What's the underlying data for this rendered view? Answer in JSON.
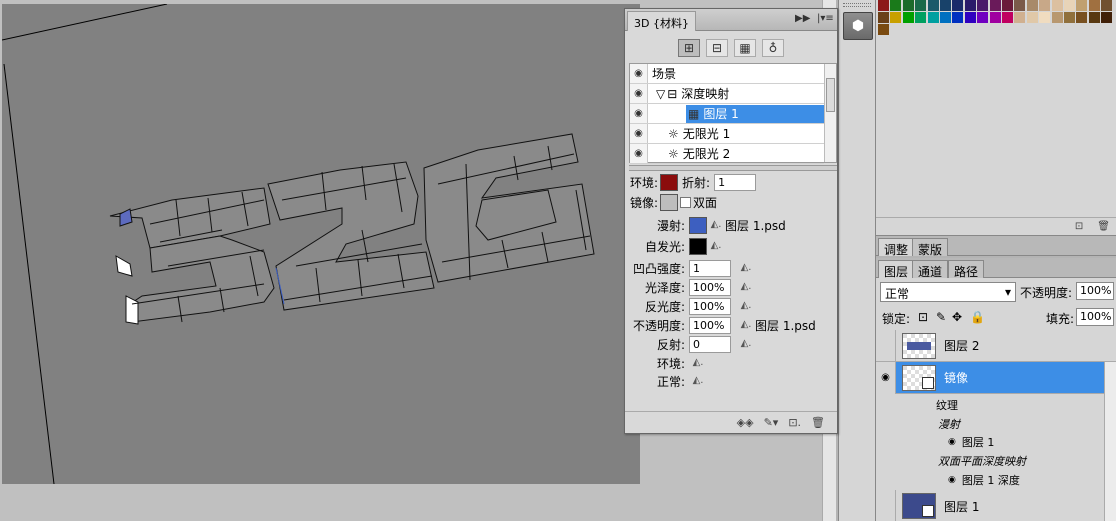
{
  "panel3d": {
    "tab_label": "3D {材料}",
    "menu_glyph": "▸▸ | ▾≡",
    "filter_icons": [
      "scene-filter-icon",
      "mesh-filter-icon",
      "material-filter-icon",
      "light-filter-icon"
    ],
    "scene_rows": [
      {
        "label": "场景",
        "indent": 0,
        "icon": ""
      },
      {
        "label": "深度映射",
        "indent": 1,
        "icon": "▽ ⊟"
      },
      {
        "label": "图层 1",
        "indent": 3,
        "icon": "▦",
        "selected": true
      },
      {
        "label": "无限光 1",
        "indent": 2,
        "icon": "☼"
      },
      {
        "label": "无限光 2",
        "indent": 2,
        "icon": "☼"
      }
    ],
    "props": {
      "ambient_label": "环境:",
      "refraction_label": "折射:",
      "refraction_value": "1",
      "specular_label": "镜像:",
      "double_sided_label": "双面",
      "diffuse_label": "漫射:",
      "diffuse_texture": "图层 1.psd",
      "self_illum_label": "自发光:",
      "bump_label": "凹凸强度:",
      "bump_value": "1",
      "gloss_label": "光泽度:",
      "gloss_value": "100%",
      "shine_label": "反光度:",
      "shine_value": "100%",
      "opacity_label": "不透明度:",
      "opacity_value": "100%",
      "opacity_texture": "图层 1.psd",
      "reflection_label": "反射:",
      "reflection_value": "0",
      "environment_label": "环境:",
      "normal_label": "正常:"
    },
    "colors": {
      "ambient": "#8b0c0c",
      "specular": "#bdbdbd",
      "diffuse": "#3d5fc0",
      "self_illum": "#000000"
    }
  },
  "adjust_tabs": [
    "调整",
    "蒙版"
  ],
  "layer_tabs": [
    "图层",
    "通道",
    "路径"
  ],
  "layers_panel": {
    "blend_mode": "正常",
    "opacity_label": "不透明度:",
    "opacity_value": "100%",
    "lock_label": "锁定:",
    "fill_label": "填充:",
    "fill_value": "100%",
    "layers": [
      {
        "name": "图层 2",
        "visible": false,
        "selected": false
      },
      {
        "name": "镜像",
        "visible": true,
        "selected": true
      },
      {
        "name": "图层 1",
        "visible": false,
        "selected": false
      }
    ],
    "sublayers": [
      {
        "label": "纹理",
        "italic": false
      },
      {
        "label": "漫射",
        "italic": true
      },
      {
        "label": "图层 1",
        "italic": false,
        "eye": true
      },
      {
        "label": "双面平面深度映射",
        "italic": true
      },
      {
        "label": "图层 1 深度",
        "italic": false,
        "eye": true
      }
    ]
  },
  "canvas": {
    "text_art": "526"
  }
}
